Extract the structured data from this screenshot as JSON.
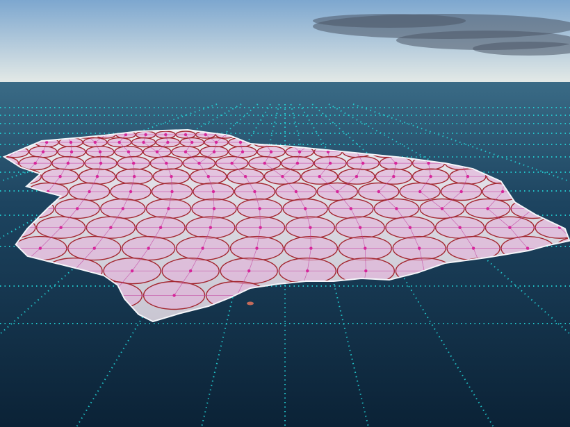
{
  "image": {
    "subject": "aerial-photo-ice-floe-with-circle-packing-overlay",
    "colors": {
      "sky_top": "#7da7cf",
      "sky_horizon": "#e6ebe7",
      "sea_far": "#3a6b86",
      "sea_mid": "#1d4460",
      "sea_near": "#0b2236",
      "ice": "#e9e8ee",
      "ice_shadow": "#c9c6d2",
      "circle_fill": "#e3b3da",
      "circle_stroke": "#a3262f",
      "node": "#d6259a",
      "link": "#c03a9e",
      "grid": "#22d3d6",
      "cloud": "#4b5566"
    },
    "overlay": {
      "grid_style": "dotted-perspective",
      "circle_rows": 11,
      "shows_node_links": true
    }
  }
}
